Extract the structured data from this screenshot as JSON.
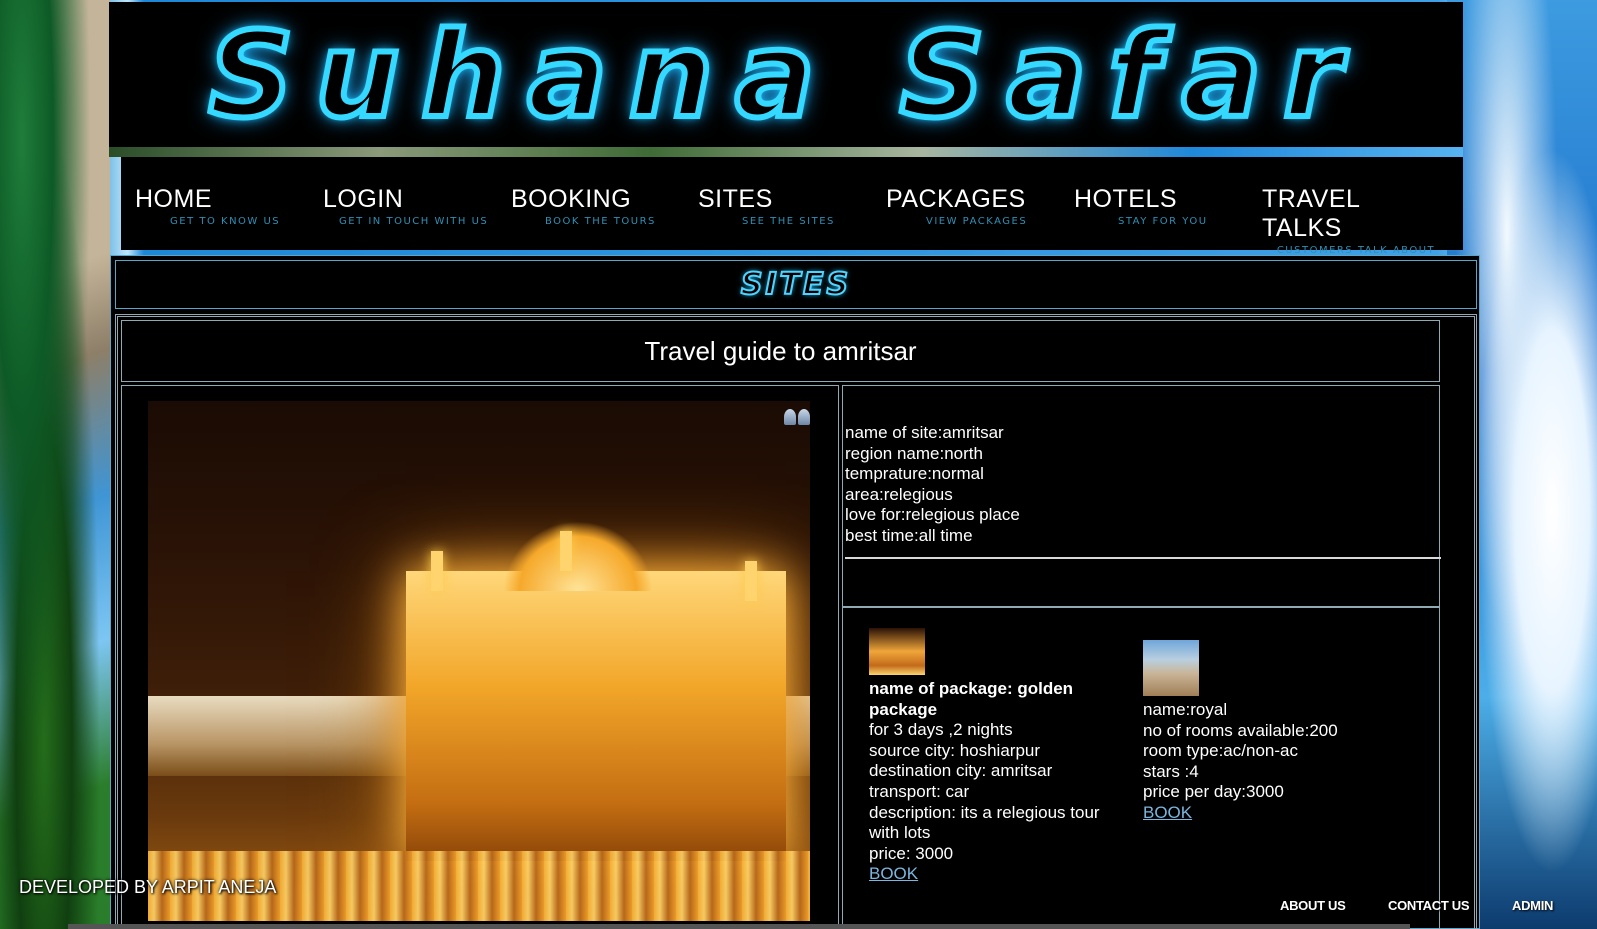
{
  "banner": {
    "title": "Suhana Safar"
  },
  "nav": [
    {
      "label": "HOME",
      "sub": "GET TO KNOW US"
    },
    {
      "label": "LOGIN",
      "sub": "GET IN TOUCH WITH US"
    },
    {
      "label": "BOOKING",
      "sub": "BOOK THE TOURS"
    },
    {
      "label": "SITES",
      "sub": "SEE THE SITES"
    },
    {
      "label": "PACKAGES",
      "sub": "VIEW PACKAGES"
    },
    {
      "label": "HOTELS",
      "sub": "STAY FOR YOU"
    },
    {
      "label": "TRAVEL TALKS",
      "sub": "CUSTOMERS TALK ABOUT TRAVEL"
    }
  ],
  "section_title": "SITES",
  "guide_title": "Travel guide to amritsar",
  "site_info": [
    "name of site:amritsar",
    "region name:north",
    "temprature:normal",
    "area:relegious",
    "love for:relegious place",
    "best time:all time"
  ],
  "package": {
    "name_line1": "name of package: golden",
    "name_line2": "package",
    "lines": [
      "for 3 days ,2 nights",
      "source city: hoshiarpur",
      "destination city: amritsar",
      "transport: car",
      "description: its a relegious tour",
      "with lots",
      "price: 3000"
    ],
    "book_label": "BOOK"
  },
  "hotel": {
    "lines": [
      "name:royal",
      "no of rooms available:200",
      "room type:ac/non-ac",
      "stars :4",
      "price per day:3000"
    ],
    "book_label": "BOOK"
  },
  "footer": {
    "credit": "DEVELOPED BY ARPIT ANEJA",
    "about": "ABOUT US",
    "contact": "CONTACT US",
    "admin": "ADMIN"
  },
  "colors": {
    "neon": "#35d8ff",
    "nav_sub": "#2f8fb5",
    "link": "#7bb6df",
    "frame_border": "#8fa9b5"
  },
  "icons": [
    "share-icon"
  ]
}
